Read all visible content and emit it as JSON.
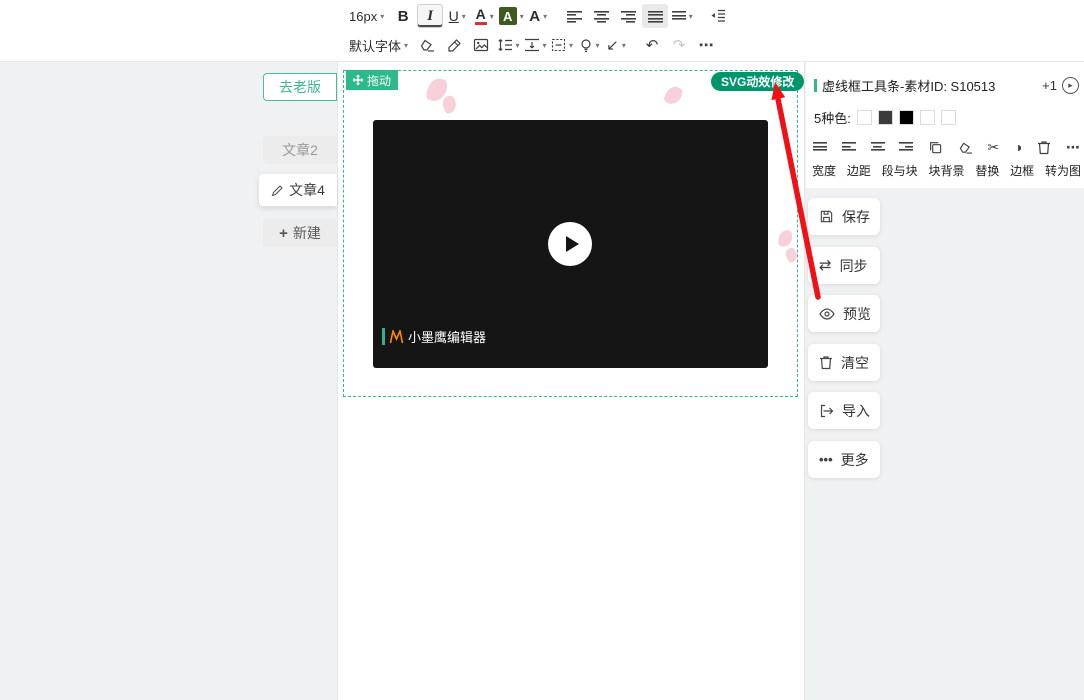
{
  "colors": {
    "accent": "#2cb98c",
    "badge_dark": "#00966b",
    "arrow_red": "#f01015"
  },
  "toolbar": {
    "font_size": "16px",
    "font_family": "默认字体",
    "bold": "B",
    "italic": "I",
    "underline": "U",
    "font_color": "A",
    "highlight": "A",
    "text_style": "A"
  },
  "icons": {
    "caret": "▾",
    "undo": "↶",
    "redo": "↷",
    "more": "⋯",
    "ellipsis": "•••",
    "scissors": "✂",
    "contrast": "◑",
    "plus": "+",
    "arrow_sw": "↙",
    "sync": "⇄",
    "circle_arrow": "▸"
  },
  "sidebar": {
    "old_version": "去老版",
    "items": [
      "文章2",
      "文章4",
      "新建"
    ]
  },
  "canvas": {
    "drag_badge": "拖动",
    "svg_badge": "SVG动效修改",
    "watermark": "小墨鹰编辑器"
  },
  "panel": {
    "title": "虚线框工具条-素材ID: S10513",
    "counter": "+1",
    "colors_label": "5种色:",
    "swatches": [
      "#ffffff",
      "#3b3b3b",
      "#000000",
      "#ffffff",
      "#ffffff"
    ],
    "tool_labels": [
      "宽度",
      "边距",
      "段与块",
      "块背景",
      "替换",
      "边框",
      "转为图"
    ],
    "buttons": [
      "保存",
      "同步",
      "预览",
      "清空",
      "导入",
      "更多"
    ]
  }
}
